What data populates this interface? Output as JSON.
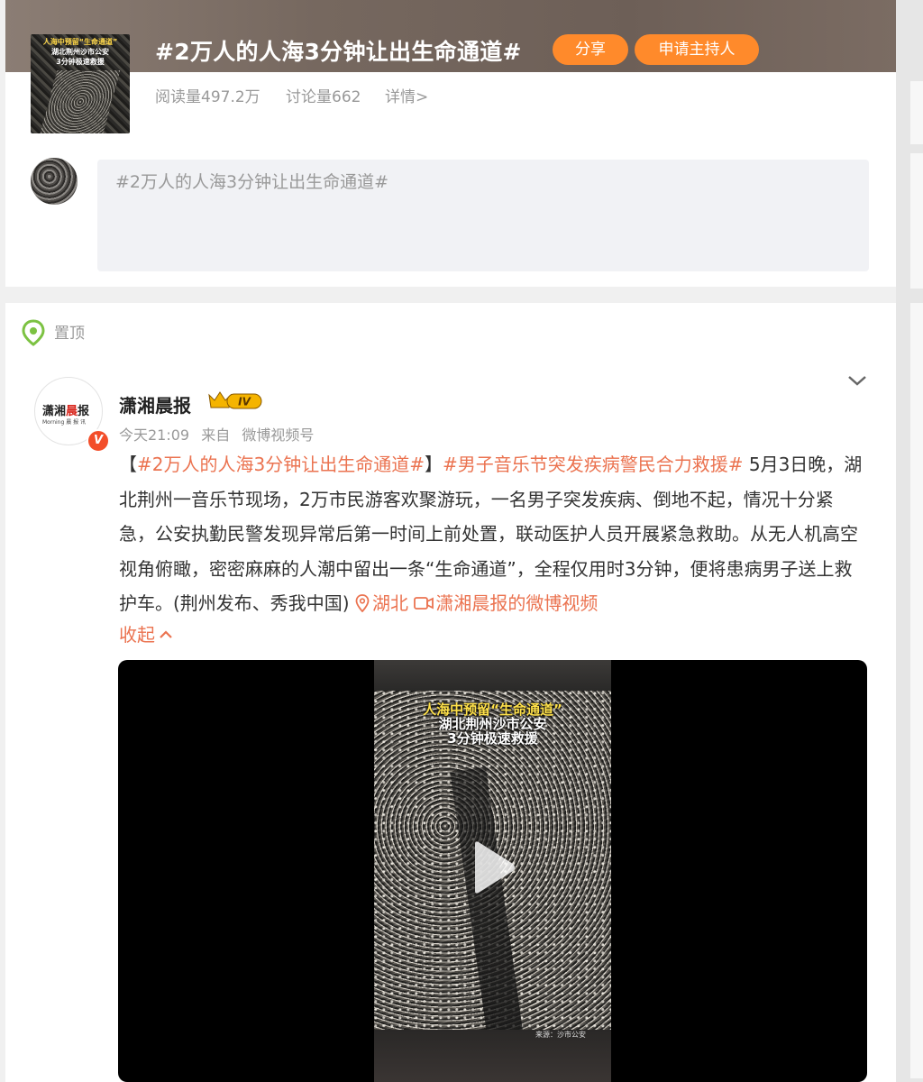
{
  "topic": {
    "title": "#2万人的人海3分钟让出生命通道#",
    "share_label": "分享",
    "host_label": "申请主持人",
    "reads": "阅读量497.2万",
    "discussions": "讨论量662",
    "detail": "详情>",
    "thumb_line1": "人海中预留“生命通道”",
    "thumb_line2": "湖北荆州沙市公安",
    "thumb_line3": "3分钟极速救援",
    "compose_placeholder": "#2万人的人海3分钟让出生命通道#"
  },
  "post": {
    "pin_label": "置顶",
    "author_name": "潇湘晨报",
    "author_logo": "潇湘晨报",
    "level": "IV",
    "verified_mark": "V",
    "time": "今天21:09",
    "source_prefix": "来自",
    "source": "微博视频号",
    "text_bracket_open": "【",
    "tag1": "#2万人的人海3分钟让出生命通道#",
    "text_bracket_close": "】",
    "tag2": "#男子音乐节突发疾病警民合力救援#",
    "body": " 5月3日晚，湖北荆州一音乐节现场，2万市民游客欢聚游玩，一名男子突发疾病、倒地不起，情况十分紧急，公安执勤民警发现异常后第一时间上前处置，联动医护人员开展紧急救助。从无人机高空视角俯瞰，密密麻麻的人潮中留出一条“生命通道”，全程仅用时3分钟，便将患病男子送上救护车。(荆州发布、秀我中国) ",
    "location": "湖北",
    "video_link": "潇湘晨报的微博视频",
    "collapse_label": "收起",
    "video": {
      "caption1": "人海中预留“生命通道”",
      "caption2": "湖北荆州沙市公安",
      "caption3": "3分钟极速救援",
      "source_label": "来源：沙市公安"
    }
  },
  "colors": {
    "accent_orange": "#ff8a2b",
    "link_orange": "#eb7350",
    "verified_red": "#f34e2a",
    "level_gold": "#f5b400"
  }
}
